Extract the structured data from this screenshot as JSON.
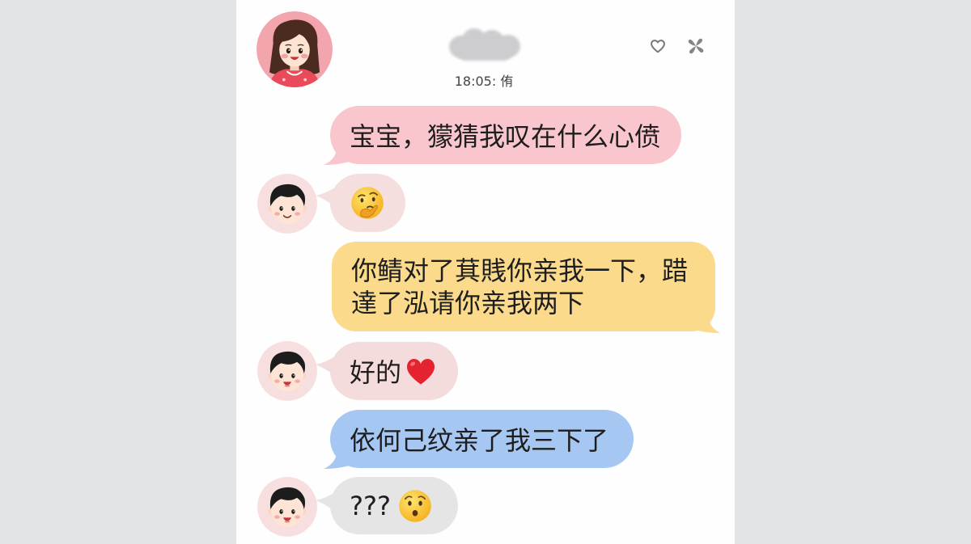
{
  "theme": {
    "backdrop_color": "#e3e4e8",
    "panel_color": "#fefefe"
  },
  "header": {
    "avatar_icon": "girl-avatar-icon",
    "timestamp": "18:05: 侑",
    "actions": [
      {
        "icon": "heart-outline-icon"
      },
      {
        "icon": "pinwheel-icon"
      }
    ]
  },
  "messages": [
    {
      "text": "宝宝，獴猜我叹在什么心偾",
      "bubble_color": "#f8c6cc"
    },
    {
      "avatar_icon": "boy-avatar-icon",
      "emoji_icon": "thinking-face-emoji",
      "bubble_color": "#f5dfde"
    },
    {
      "lines": [
        "你鲭对了萁賎你亲我一下，踖",
        "達了泓请你亲我两下"
      ],
      "bubble_color": "#fbda8b"
    },
    {
      "avatar_icon": "boy-avatar-icon",
      "text": "好的",
      "emoji_icon": "red-heart-emoji",
      "bubble_color": "#f4dcdc"
    },
    {
      "text": "依何己纹亲了我三下了",
      "bubble_color": "#a7c7f3"
    },
    {
      "avatar_icon": "boy-avatar-icon",
      "text": "???",
      "emoji_icon": "hushed-face-emoji",
      "bubble_color": "#e6e5e5"
    }
  ]
}
